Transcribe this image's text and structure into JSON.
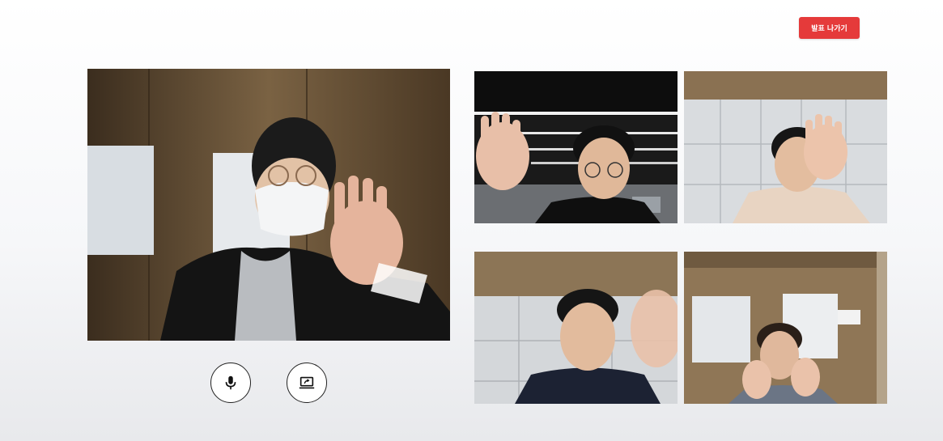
{
  "header": {
    "leave_label": "발표 나가기",
    "leave_color": "#e53a3a"
  },
  "main_video": {
    "icon": "participant-video-feed"
  },
  "participants": [
    {
      "icon": "participant-video-feed"
    },
    {
      "icon": "participant-video-feed"
    },
    {
      "icon": "participant-video-feed"
    },
    {
      "icon": "participant-video-feed"
    }
  ],
  "controls": {
    "mic_icon": "microphone-icon",
    "screen_share_icon": "screen-share-icon"
  }
}
